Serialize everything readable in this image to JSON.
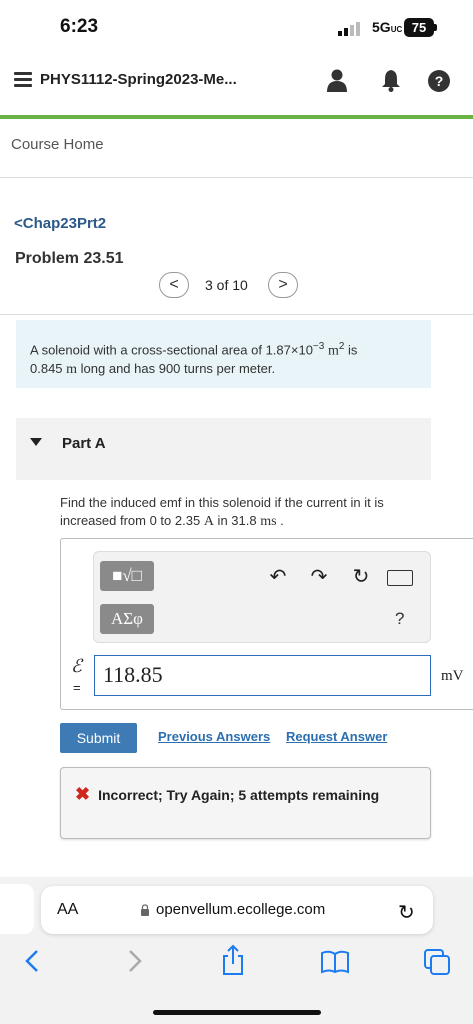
{
  "status_bar": {
    "time": "6:23",
    "network": "5G",
    "network_suffix": "UC",
    "battery": "75"
  },
  "header": {
    "course_title": "PHYS1112-Spring2023-Me...",
    "icons": [
      "menu-icon",
      "user-icon",
      "bell-icon",
      "help-icon"
    ],
    "help_label": "?"
  },
  "nav": {
    "course_home": "Course Home",
    "chapter_link": "Chap23Prt2",
    "chapter_back": "<"
  },
  "problem": {
    "title": "Problem 23.51",
    "pager": {
      "prev": "<",
      "text": "3 of 10",
      "next": ">"
    },
    "statement_1": "A solenoid with a cross-sectional area of 1.87×10",
    "statement_exp": "−3",
    "statement_unit": "m",
    "statement_unit_exp": "2",
    "statement_2": " is",
    "statement_3": "0.845 ",
    "statement_3_unit": "m",
    "statement_4": " long and has 900 turns per meter."
  },
  "part": {
    "label": "Part A",
    "question_1": "Find the induced emf in this solenoid if the current in it is increased from 0 to 2.35 ",
    "question_unit_a": "A",
    "question_2": " in 31.8 ",
    "question_unit_ms": "ms",
    "question_3": " ."
  },
  "toolbar": {
    "template_btn": "■√□",
    "greek_btn": "ΑΣφ",
    "undo": "↶",
    "redo": "↷",
    "reset": "↻",
    "help": "?"
  },
  "answer": {
    "symbol": "ℰ",
    "equals": "=",
    "value": "118.85",
    "unit": "mV"
  },
  "actions": {
    "submit": "Submit",
    "previous_answers": "Previous Answers",
    "request_answer": "Request Answer"
  },
  "feedback": {
    "icon": "✖",
    "text": "Incorrect; Try Again; 5 attempts remaining"
  },
  "safari": {
    "aa": "AA",
    "url": "openvellum.ecollege.com"
  },
  "colors": {
    "accent_green": "#6ab344",
    "link_blue": "#2b6fb0",
    "submit_blue": "#3e7bb5",
    "error_red": "#d0271d"
  }
}
